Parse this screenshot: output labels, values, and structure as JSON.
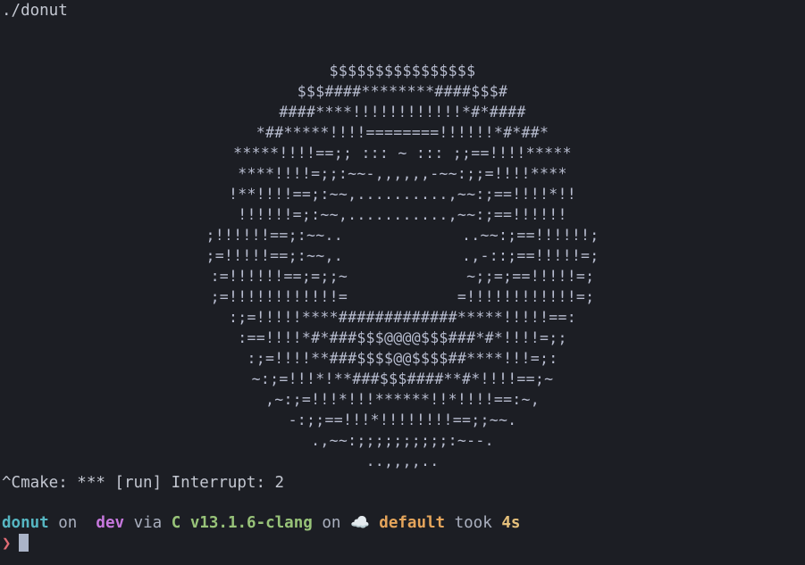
{
  "command_line": "./donut",
  "donut_rows": [
    "$$$$$$$$$$$$$$$$",
    "$$$####********####$$$#",
    "####****!!!!!!!!!!!!*#*####",
    "*##*****!!!!========!!!!!!*#*##*",
    "*****!!!!==;; ::: ~ ::: ;;==!!!!*****",
    "****!!!!=;;:~~-,,,,,,-~~:;;=!!!!****",
    "!**!!!!==;:~~,..........,~~:;==!!!!*!!",
    "!!!!!!=;:~~,...........,~~:;==!!!!!!",
    ";!!!!!!==;:~~..             ..~~:;==!!!!!!;",
    ";=!!!!!==;:~~,.             .,-::;==!!!!!=;",
    ":=!!!!!!==;=;;~             ~;;=;==!!!!!=;",
    ";=!!!!!!!!!!!!=            =!!!!!!!!!!!!=;",
    ":;=!!!!!****#############*****!!!!!==:",
    ":==!!!!*#*###$$$@@@@$$$###*#*!!!!=;;",
    ":;=!!!!**###$$$$@@$$$$##****!!!=;:",
    "~:;=!!!*!**###$$$####**#*!!!!==;~",
    ",~:;=!!!*!!!******!!*!!!!==:~,",
    "-:;;==!!!*!!!!!!!!==;;~~.",
    ".,~~:;;;;;;;;;;:~--.",
    "..,,,,.."
  ],
  "interrupt_line": "^Cmake: *** [run] Interrupt: 2",
  "prompt": {
    "directory": "donut",
    "on_1": "on",
    "branch_icon": "",
    "branch": "dev",
    "via": "via",
    "lang_icon": "C",
    "lang_version": "v13.1.6-clang",
    "on_2": "on",
    "cloud_icon": "☁️",
    "profile": "default",
    "took": "took",
    "duration": "4s"
  },
  "input_prompt": {
    "chevron": "❯"
  }
}
